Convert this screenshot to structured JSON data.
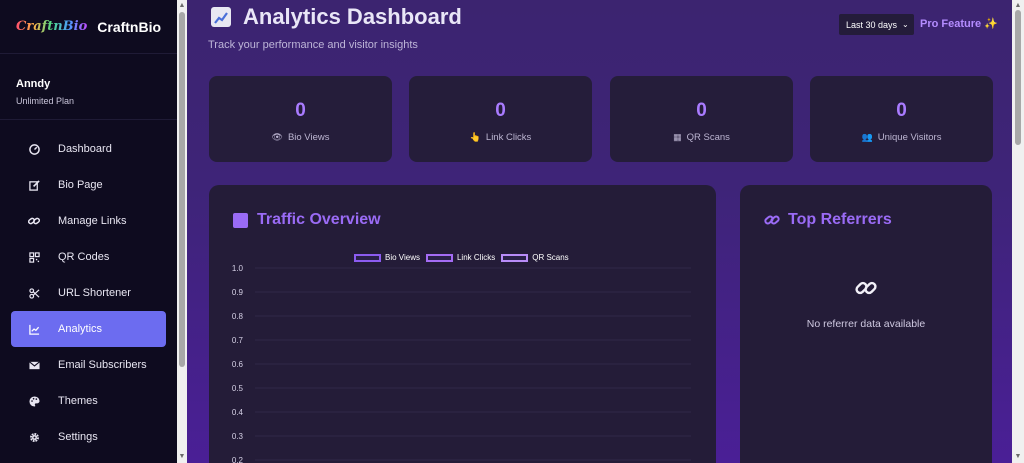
{
  "brand": {
    "logo_text": "CraftnBio",
    "name": "CraftnBio"
  },
  "user": {
    "name": "Anndy",
    "plan": "Unlimited Plan"
  },
  "nav": {
    "items": [
      {
        "label": "Dashboard",
        "icon": "gauge-icon"
      },
      {
        "label": "Bio Page",
        "icon": "edit-icon"
      },
      {
        "label": "Manage Links",
        "icon": "link-icon"
      },
      {
        "label": "QR Codes",
        "icon": "qr-icon"
      },
      {
        "label": "URL Shortener",
        "icon": "scissors-icon"
      },
      {
        "label": "Analytics",
        "icon": "chart-line-icon",
        "active": true
      },
      {
        "label": "Email Subscribers",
        "icon": "envelope-icon"
      },
      {
        "label": "Themes",
        "icon": "palette-icon"
      },
      {
        "label": "Settings",
        "icon": "gear-icon"
      }
    ]
  },
  "header": {
    "title": "Analytics Dashboard",
    "subtitle": "Track your performance and visitor insights",
    "range": "Last 30 days",
    "pro_label": "Pro Feature ✨"
  },
  "stats": [
    {
      "value": "0",
      "label": "Bio Views",
      "icon": "👁"
    },
    {
      "value": "0",
      "label": "Link Clicks",
      "icon": "👆"
    },
    {
      "value": "0",
      "label": "QR Scans",
      "icon": "▦"
    },
    {
      "value": "0",
      "label": "Unique Visitors",
      "icon": "👥"
    }
  ],
  "traffic": {
    "title": "Traffic Overview"
  },
  "referrers": {
    "title": "Top Referrers",
    "empty": "No referrer data available"
  },
  "colors": {
    "accent": "#9a6bf5",
    "active_nav": "#6c6cf0",
    "sidebar_bg": "#0e0b1f",
    "card_bg": "#241c38"
  },
  "chart_data": {
    "type": "line",
    "title": "",
    "series": [
      {
        "name": "Bio Views",
        "values": []
      },
      {
        "name": "Link Clicks",
        "values": []
      },
      {
        "name": "QR Scans",
        "values": []
      }
    ],
    "y_ticks": [
      "1.0",
      "0.9",
      "0.8",
      "0.7",
      "0.6",
      "0.5",
      "0.4",
      "0.3",
      "0.2"
    ],
    "ylim": [
      0,
      1
    ],
    "grid": true,
    "legend": "top"
  }
}
